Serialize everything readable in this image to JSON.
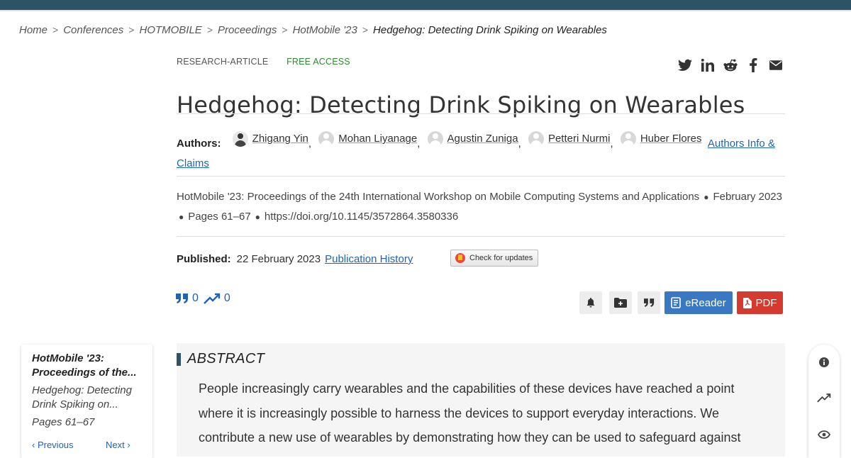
{
  "breadcrumb": {
    "items": [
      "Home",
      "Conferences",
      "HOTMOBILE",
      "Proceedings",
      "HotMobile '23"
    ],
    "current": "Hedgehog: Detecting Drink Spiking on Wearables",
    "separator": ">"
  },
  "article": {
    "type": "RESEARCH-ARTICLE",
    "access": "FREE ACCESS",
    "title": "Hedgehog: Detecting Drink Spiking on Wearables"
  },
  "share": {
    "icons": [
      "twitter-icon",
      "linkedin-icon",
      "reddit-icon",
      "facebook-icon",
      "email-icon"
    ]
  },
  "authors": {
    "label": "Authors:",
    "list": [
      "Zhigang Yin",
      "Mohan Liyanage",
      "Agustin Zuniga",
      "Petteri Nurmi",
      "Huber Flores"
    ],
    "info_link": "Authors Info & Claims"
  },
  "publication": {
    "proceedings": "HotMobile '23: Proceedings of the 24th International Workshop on Mobile Computing Systems and Applications",
    "date": "February 2023",
    "pages": "Pages 61–67",
    "doi": "https://doi.org/10.1145/3572864.3580336"
  },
  "published": {
    "label": "Published:",
    "date": "22 February 2023",
    "history_link": "Publication History",
    "check_updates": "Check for updates"
  },
  "metrics": {
    "citations": "0",
    "downloads": "0"
  },
  "actions": {
    "ereader": "eReader",
    "pdf": "PDF"
  },
  "sidecard": {
    "proceedings": "HotMobile '23: Proceedings of the...",
    "title": "Hedgehog: Detecting Drink Spiking on...",
    "pages": "Pages 61–67",
    "previous": "Previous",
    "next": "Next"
  },
  "abstract": {
    "heading": "ABSTRACT",
    "text": "People increasingly carry wearables and the capabilities of these devices have reached a point where it is increasingly possible to harness the devices to support everyday interactions. We contribute a new use of wearables by demonstrating how they can be used to safeguard against"
  },
  "colors": {
    "topbar": "#2b5566",
    "link": "#1f63b5",
    "free_access": "#2f8a2f",
    "ereader": "#3a78c3",
    "pdf": "#d53a2e"
  }
}
